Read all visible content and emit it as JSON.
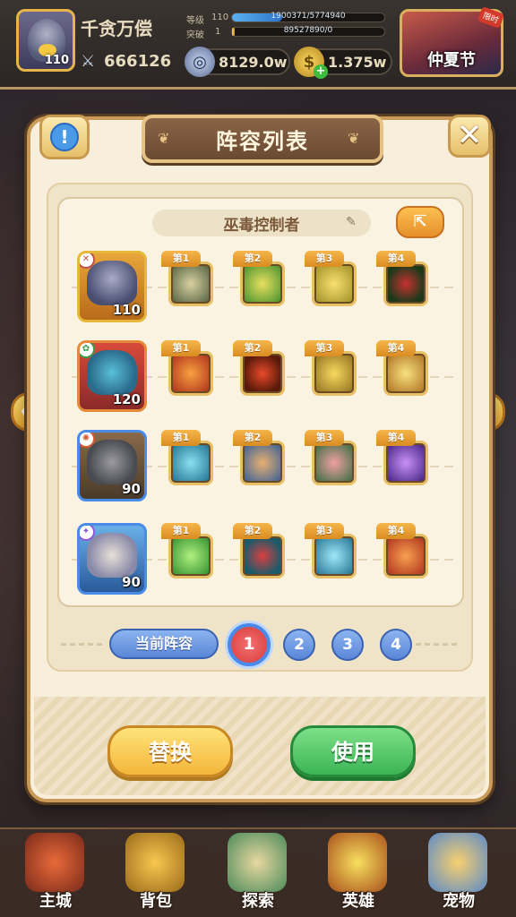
{
  "player": {
    "name": "千贪万偿",
    "level": "110",
    "power": "666126",
    "rank_label": "等级",
    "rank_value": "110",
    "rank_progress_text": "1900371/5774940",
    "rank_progress": 0.33,
    "breakthrough_label": "突破",
    "breakthrough_value": "1",
    "breakthrough_progress_text": "89527890/0",
    "breakthrough_progress": 0.02
  },
  "currency": {
    "silver": "8129.0w",
    "gold": "1.375w"
  },
  "event": {
    "name": "仲夏节",
    "tag": "限时"
  },
  "modal": {
    "title": "阵容列表",
    "lineup_name": "巫毒控制者",
    "current_label": "当前阵容",
    "pages": [
      "1",
      "2",
      "3",
      "4"
    ],
    "active_page": 0,
    "replace_label": "替换",
    "use_label": "使用"
  },
  "lineup": [
    {
      "level": "110",
      "skills": [
        "第1",
        "第2",
        "第3",
        "第4"
      ]
    },
    {
      "level": "120",
      "skills": [
        "第1",
        "第2",
        "第3",
        "第4"
      ]
    },
    {
      "level": "90",
      "skills": [
        "第1",
        "第2",
        "第3",
        "第4"
      ]
    },
    {
      "level": "90",
      "skills": [
        "第1",
        "第2",
        "第3",
        "第4"
      ]
    }
  ],
  "nav": [
    {
      "label": "主城",
      "icon": "castle-icon"
    },
    {
      "label": "背包",
      "icon": "bag-icon"
    },
    {
      "label": "探索",
      "icon": "map-icon"
    },
    {
      "label": "英雄",
      "icon": "hero-icon"
    },
    {
      "label": "宠物",
      "icon": "pet-icon"
    }
  ],
  "colors": {
    "modal_bg": "#f7eedb",
    "gold_accent": "#e6c284",
    "replace_button": "#f4b63a",
    "use_button": "#3cb456",
    "page_active": "#d83a3a",
    "page_inactive": "#5a86d8"
  }
}
